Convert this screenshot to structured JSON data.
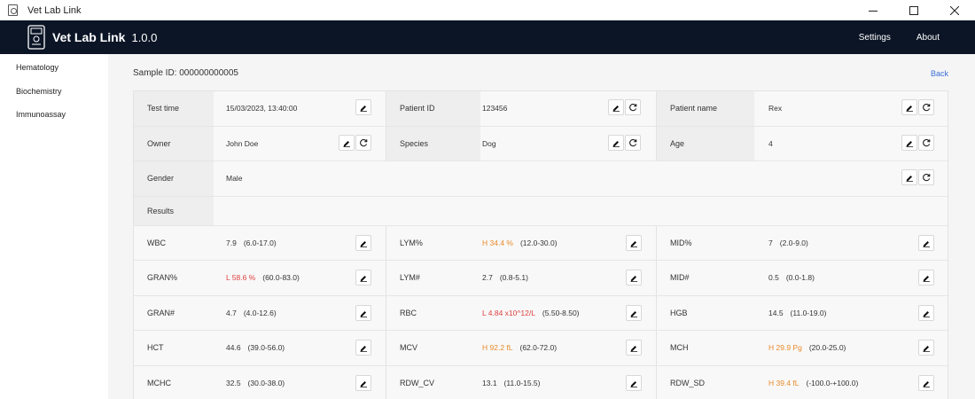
{
  "window": {
    "title": "Vet Lab Link",
    "icons": {
      "app": "app-icon",
      "minimize": "minimize-icon",
      "maximize": "maximize-icon",
      "close": "close-icon"
    }
  },
  "header": {
    "brand": "Vet Lab Link",
    "version": "1.0.0",
    "links": {
      "settings": "Settings",
      "about": "About"
    },
    "logo_icon": "analyzer-device-icon",
    "background": "#0b1526"
  },
  "sidebar": {
    "items": [
      {
        "label": "Hematology"
      },
      {
        "label": "Biochemistry"
      },
      {
        "label": "Immunoassay"
      }
    ]
  },
  "main": {
    "sample_id": "Sample ID: 000000000005",
    "back": "Back",
    "info": {
      "test_time": {
        "label": "Test time",
        "value": "15/03/2023, 13:40:00"
      },
      "patient_id": {
        "label": "Patient ID",
        "value": "123456"
      },
      "patient_name": {
        "label": "Patient name",
        "value": "Rex"
      },
      "owner": {
        "label": "Owner",
        "value": "John Doe"
      },
      "species": {
        "label": "Species",
        "value": "Dog"
      },
      "age": {
        "label": "Age",
        "value": "4"
      },
      "gender": {
        "label": "Gender",
        "value": "Male"
      }
    },
    "results_label": "Results",
    "results": [
      [
        {
          "name": "WBC",
          "value": "7.9",
          "range": "(6.0-17.0)",
          "flag": ""
        },
        {
          "name": "LYM%",
          "value": "H 34.4 %",
          "range": "(12.0-30.0)",
          "flag": "H"
        },
        {
          "name": "MID%",
          "value": "7",
          "range": "(2.0-9.0)",
          "flag": ""
        }
      ],
      [
        {
          "name": "GRAN%",
          "value": "L 58.6 %",
          "range": "(60.0-83.0)",
          "flag": "L"
        },
        {
          "name": "LYM#",
          "value": "2.7",
          "range": "(0.8-5.1)",
          "flag": ""
        },
        {
          "name": "MID#",
          "value": "0.5",
          "range": "(0.0-1.8)",
          "flag": ""
        }
      ],
      [
        {
          "name": "GRAN#",
          "value": "4.7",
          "range": "(4.0-12.6)",
          "flag": ""
        },
        {
          "name": "RBC",
          "value": "L 4.84 x10^12/L",
          "range": "(5.50-8.50)",
          "flag": "L"
        },
        {
          "name": "HGB",
          "value": "14.5",
          "range": "(11.0-19.0)",
          "flag": ""
        }
      ],
      [
        {
          "name": "HCT",
          "value": "44.6",
          "range": "(39.0-56.0)",
          "flag": ""
        },
        {
          "name": "MCV",
          "value": "H 92.2 fL",
          "range": "(62.0-72.0)",
          "flag": "H"
        },
        {
          "name": "MCH",
          "value": "H 29.9 Pg",
          "range": "(20.0-25.0)",
          "flag": "H"
        }
      ],
      [
        {
          "name": "MCHC",
          "value": "32.5",
          "range": "(30.0-38.0)",
          "flag": ""
        },
        {
          "name": "RDW_CV",
          "value": "13.1",
          "range": "(11.0-15.5)",
          "flag": ""
        },
        {
          "name": "RDW_SD",
          "value": "H 39.4 fL",
          "range": "(-100.0-+100.0)",
          "flag": "H"
        }
      ]
    ],
    "colors": {
      "high_flag": "#e88a2a",
      "low_flag": "#e04040",
      "link": "#3b6fd8"
    },
    "action_icons": {
      "edit": "edit-icon",
      "reset": "reset-icon"
    }
  }
}
